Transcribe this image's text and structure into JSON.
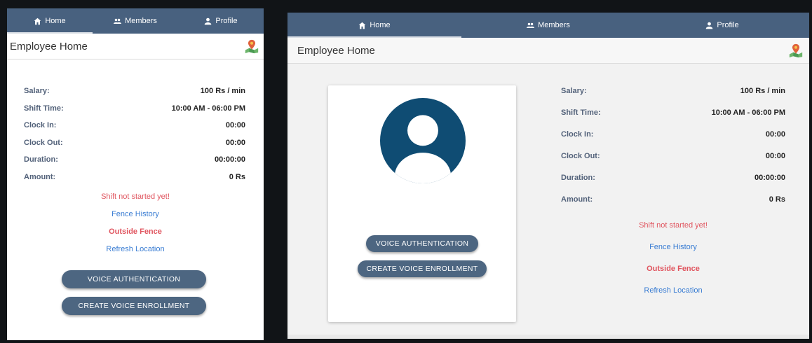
{
  "nav": {
    "tabs": [
      {
        "label": "Home",
        "icon": "home-icon",
        "active": true
      },
      {
        "label": "Members",
        "icon": "members-icon",
        "active": false
      },
      {
        "label": "Profile",
        "icon": "profile-icon",
        "active": false
      }
    ]
  },
  "header": {
    "title": "Employee Home",
    "icon": "map-location-icon"
  },
  "info": {
    "salary_label": "Salary:",
    "salary_value": "100 Rs / min",
    "shift_label": "Shift Time:",
    "shift_value": "10:00 AM - 06:00 PM",
    "clock_in_label": "Clock In:",
    "clock_in_value": "00:00",
    "clock_out_label": "Clock Out:",
    "clock_out_value": "00:00",
    "duration_label": "Duration:",
    "duration_value": "00:00:00",
    "amount_label": "Amount:",
    "amount_value": "0 Rs"
  },
  "status": {
    "shift_status": "Shift not started yet!",
    "fence_history": "Fence History",
    "fence_state": "Outside Fence",
    "refresh_location": "Refresh Location"
  },
  "buttons": {
    "voice_auth": "VOICE AUTHENTICATION",
    "voice_enroll": "CREATE VOICE ENROLLMENT"
  },
  "colors": {
    "nav_bar": "#48617f",
    "button": "#4d6681",
    "alert_red": "#e0555f",
    "link_blue": "#3a7dd3",
    "avatar": "#0f4c73"
  }
}
